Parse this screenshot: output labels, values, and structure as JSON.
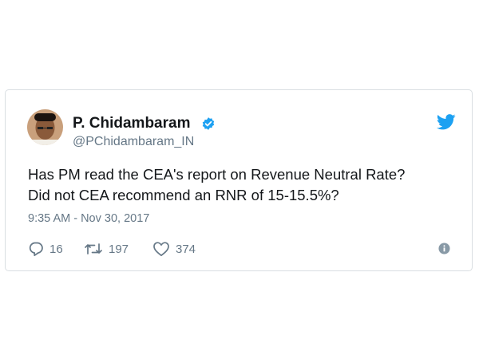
{
  "tweet": {
    "display_name": "P. Chidambaram",
    "handle": "@PChidambaram_IN",
    "text_lines": [
      "Has PM read the CEA's report on Revenue Neutral Rate?",
      "Did not CEA recommend an RNR of 15-15.5%?"
    ],
    "timestamp": "9:35 AM - Nov 30, 2017",
    "verified": true,
    "counts": {
      "replies": "16",
      "retweets": "197",
      "likes": "374"
    }
  },
  "icons": {
    "verified": "verified-badge-icon",
    "brand": "twitter-bird-icon",
    "reply": "reply-icon",
    "retweet": "retweet-icon",
    "like": "heart-icon",
    "info": "info-icon"
  },
  "colors": {
    "brand_blue": "#1da1f2",
    "text": "#14171a",
    "secondary_text": "#657786",
    "border": "#d9dee2"
  }
}
